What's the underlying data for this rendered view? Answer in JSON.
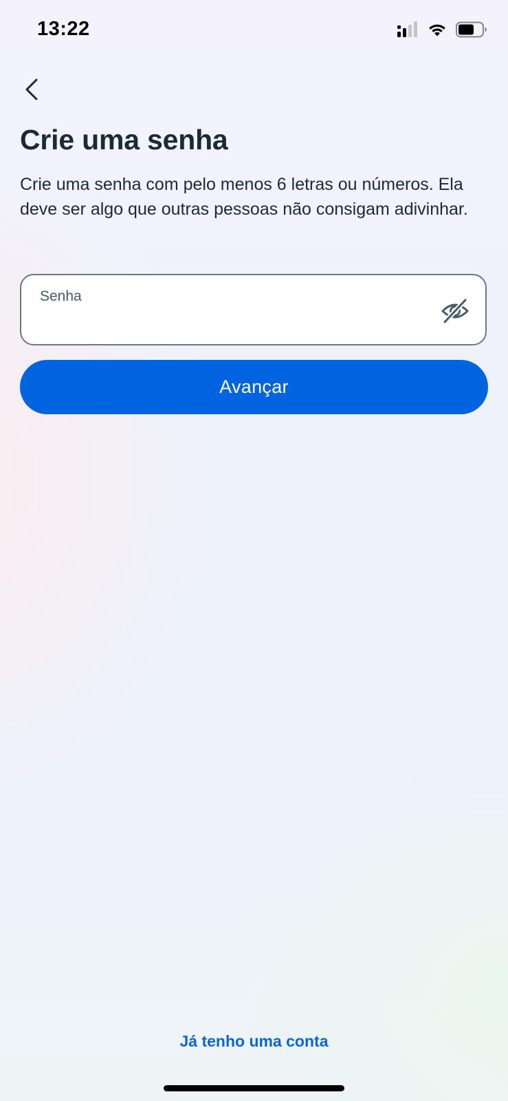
{
  "status_bar": {
    "time": "13:22",
    "icons": [
      "signal-icon",
      "wifi-icon",
      "battery-icon"
    ]
  },
  "header": {
    "back_icon": "chevron-left-icon"
  },
  "main": {
    "title": "Crie uma senha",
    "description": "Crie uma senha com pelo menos 6 letras ou números. Ela deve ser algo que outras pessoas não consigam adivinhar.",
    "password_field": {
      "label": "Senha",
      "value": "",
      "toggle_icon": "eye-off-icon"
    },
    "next_button_label": "Avançar"
  },
  "footer": {
    "login_link": "Já tenho uma conta"
  },
  "colors": {
    "primary_button": "#0064e0",
    "link": "#0a66d8",
    "text": "#1c2b33",
    "field_border": "#6a7783"
  }
}
